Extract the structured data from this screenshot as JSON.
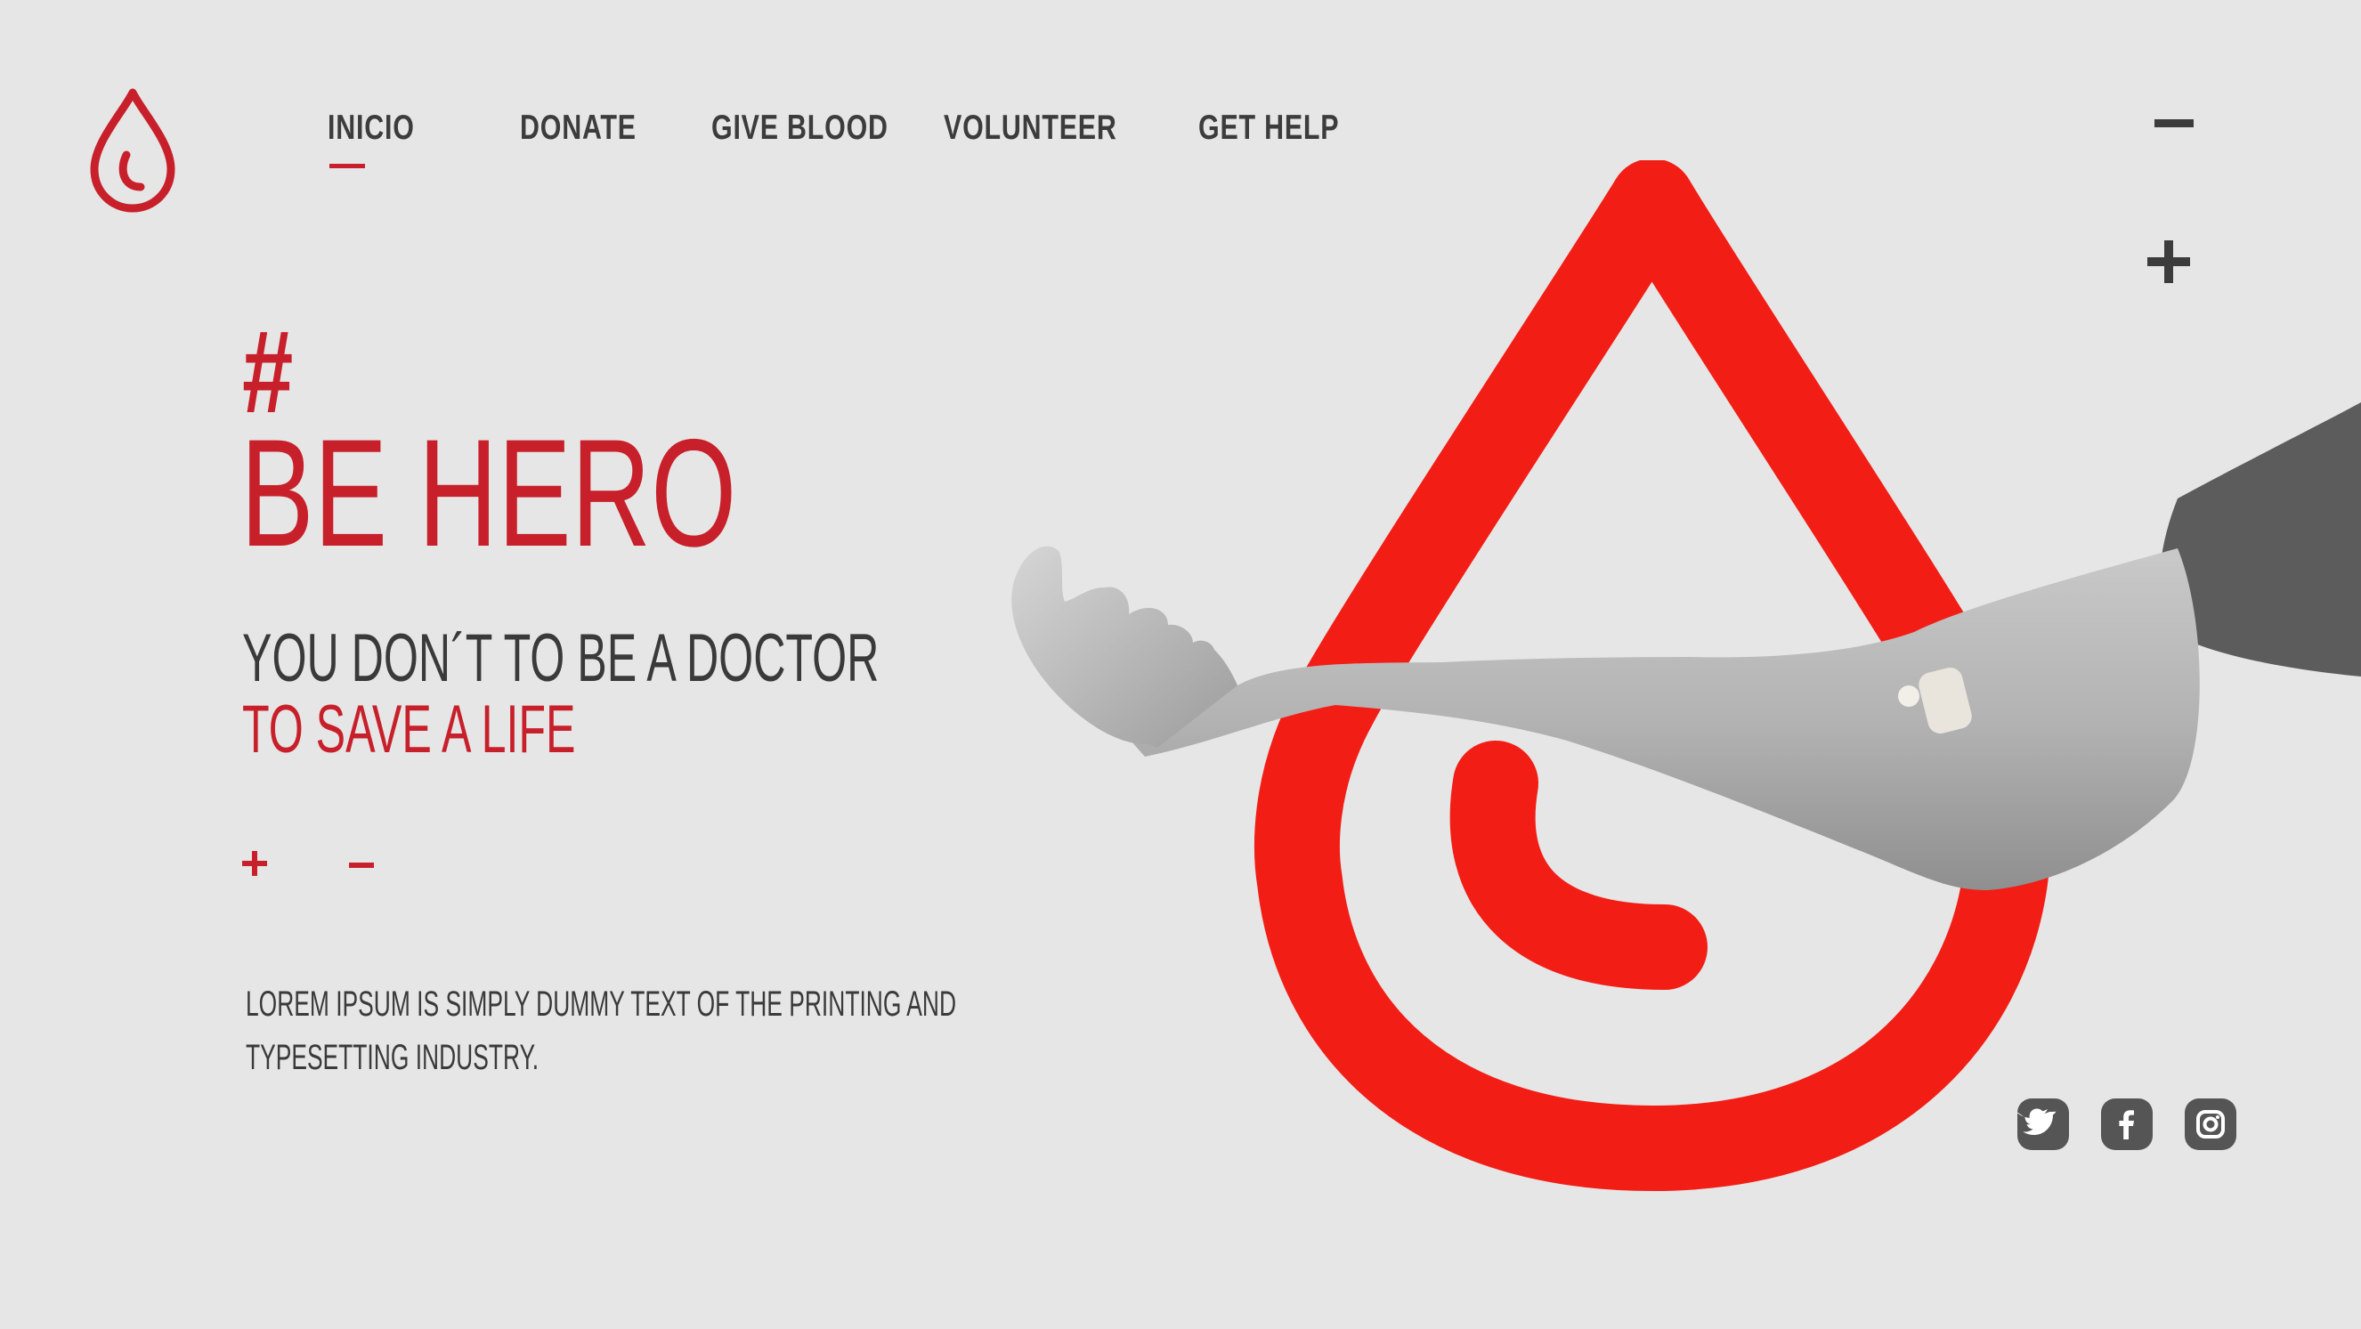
{
  "nav": {
    "items": [
      {
        "label": "INICIO"
      },
      {
        "label": "DONATE"
      },
      {
        "label": "GIVE BLOOD"
      },
      {
        "label": "VOLUNTEER"
      },
      {
        "label": "GET HELP"
      }
    ],
    "active_index": 0
  },
  "controls": {
    "zoom_out_icon": "minus-icon",
    "zoom_in_icon": "plus-icon"
  },
  "hero": {
    "hashtag": "#",
    "title": "BE HERO",
    "subtitle_line1": "YOU DON´T TO BE A DOCTOR",
    "subtitle_line2": "TO SAVE A LIFE",
    "description_line1": "LOREM IPSUM IS SIMPLY DUMMY TEXT OF THE PRINTING AND",
    "description_line2": "TYPESETTING INDUSTRY."
  },
  "social": [
    "twitter-icon",
    "facebook-icon",
    "instagram-icon"
  ],
  "colors": {
    "accent": "#c8202a",
    "drop_red": "#f21e16",
    "text_dark": "#3a3a3a",
    "background": "#e6e6e6"
  }
}
